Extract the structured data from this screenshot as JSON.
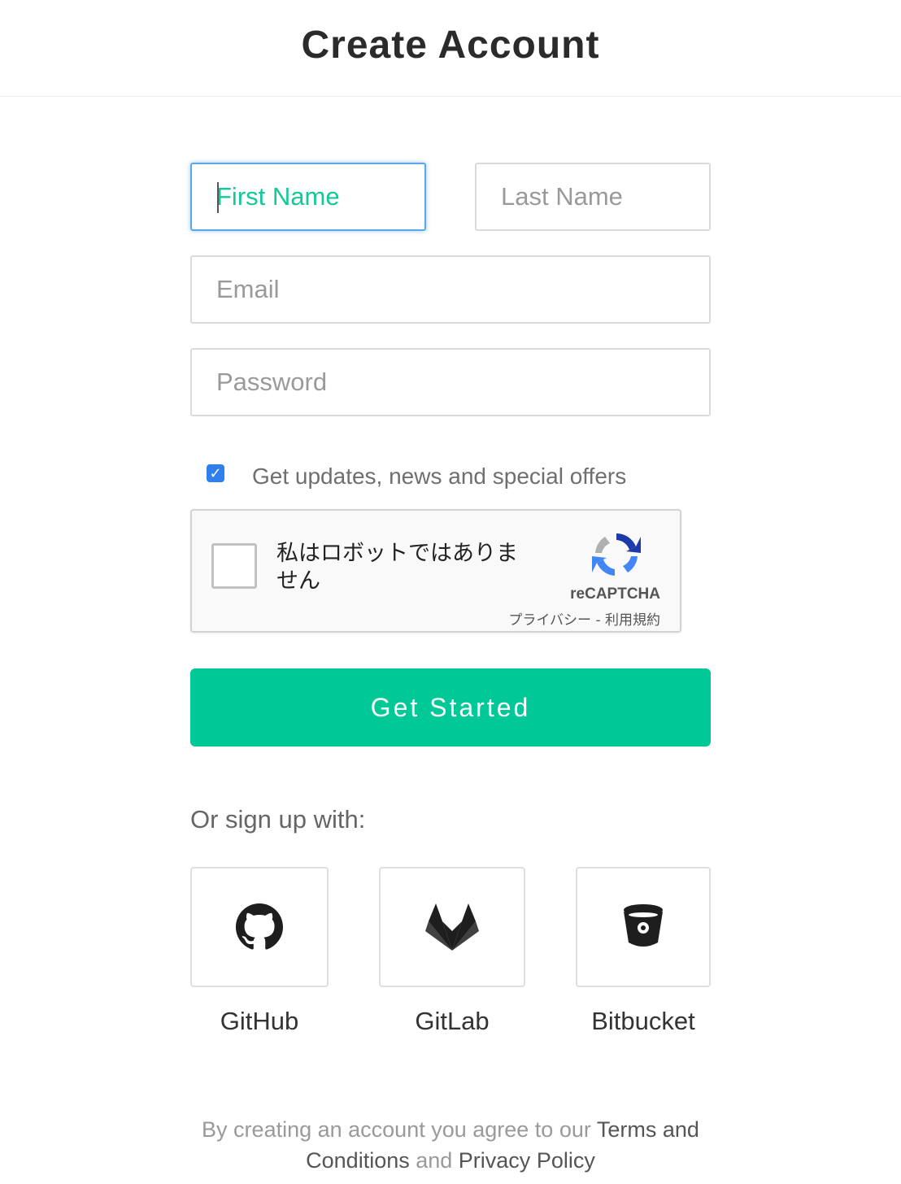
{
  "header": {
    "title": "Create Account"
  },
  "form": {
    "first_name_placeholder": "First Name",
    "last_name_placeholder": "Last Name",
    "email_placeholder": "Email",
    "password_placeholder": "Password",
    "newsletter_checked": true,
    "newsletter_label": "Get updates, news and special offers",
    "submit_label": "Get Started"
  },
  "recaptcha": {
    "checkbox_text": "私はロボットではありません",
    "brand": "reCAPTCHA",
    "links": "プライバシー - 利用規約"
  },
  "social": {
    "label": "Or sign up with:",
    "providers": [
      {
        "name": "GitHub",
        "icon": "github-icon"
      },
      {
        "name": "GitLab",
        "icon": "gitlab-icon"
      },
      {
        "name": "Bitbucket",
        "icon": "bitbucket-icon"
      }
    ]
  },
  "footer": {
    "prefix": "By creating an account you agree to our ",
    "terms_link": "Terms and Conditions",
    "conjunction": " and ",
    "privacy_link": "Privacy Policy"
  },
  "colors": {
    "accent": "#00c896",
    "focus_border": "#5aa8e8",
    "checkbox": "#2f80ed"
  }
}
